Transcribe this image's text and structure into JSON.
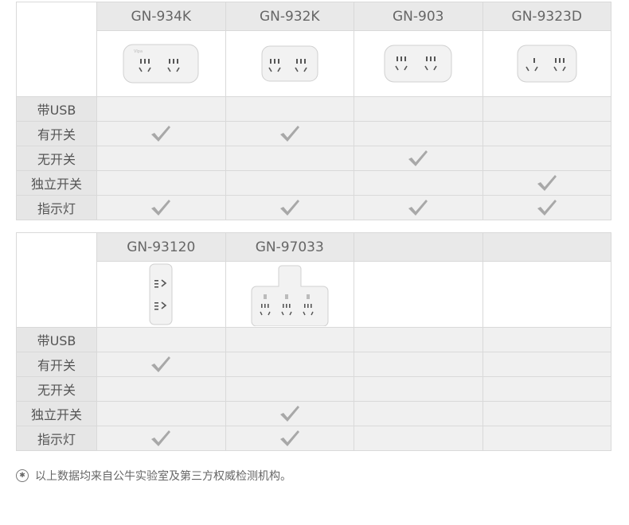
{
  "table1": {
    "models": [
      "GN-934K",
      "GN-932K",
      "GN-903",
      "GN-9323D"
    ],
    "rows": [
      {
        "label": "带USB",
        "checks": [
          false,
          false,
          false,
          false
        ]
      },
      {
        "label": "有开关",
        "checks": [
          true,
          true,
          false,
          false
        ]
      },
      {
        "label": "无开关",
        "checks": [
          false,
          false,
          true,
          false
        ]
      },
      {
        "label": "独立开关",
        "checks": [
          false,
          false,
          false,
          true
        ]
      },
      {
        "label": "指示灯",
        "checks": [
          true,
          true,
          true,
          true
        ]
      }
    ]
  },
  "table2": {
    "models": [
      "GN-93120",
      "GN-97033",
      "",
      ""
    ],
    "rows": [
      {
        "label": "带USB",
        "checks": [
          false,
          false,
          false,
          false
        ]
      },
      {
        "label": "有开关",
        "checks": [
          true,
          false,
          false,
          false
        ]
      },
      {
        "label": "无开关",
        "checks": [
          false,
          false,
          false,
          false
        ]
      },
      {
        "label": "独立开关",
        "checks": [
          false,
          true,
          false,
          false
        ]
      },
      {
        "label": "指示灯",
        "checks": [
          true,
          true,
          false,
          false
        ]
      }
    ]
  },
  "footnote": {
    "text": "以上数据均来自公牛实验室及第三方权威检测机构。",
    "icon": "asterisk-circle-icon"
  },
  "colors": {
    "header_bg": "#e9e9e9",
    "label_bg": "#e6e6e6",
    "cell_bg": "#f0f0f0",
    "check": "#a8a8a8"
  }
}
